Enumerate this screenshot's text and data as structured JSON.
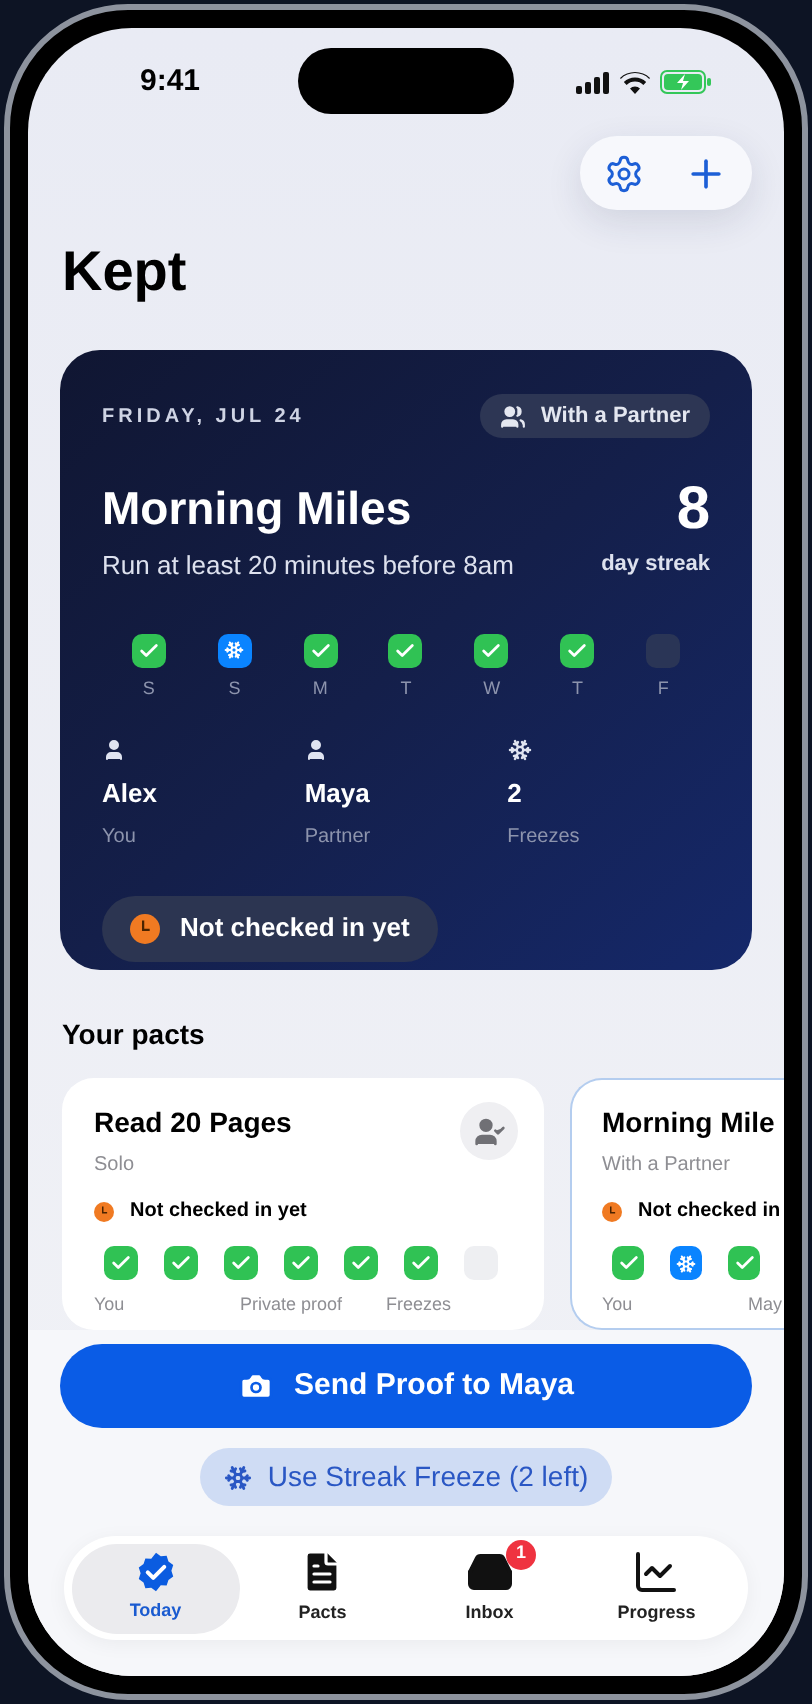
{
  "status_bar": {
    "time": "9:41"
  },
  "header": {
    "title": "Kept"
  },
  "hero": {
    "date": "FRIDAY, JUL 24",
    "badge": "With a Partner",
    "title": "Morning Miles",
    "subtitle": "Run at least 20 minutes before 8am",
    "streak": "8",
    "streak_label": "day streak",
    "days": [
      {
        "label": "S",
        "kind": "check"
      },
      {
        "label": "S",
        "kind": "freeze"
      },
      {
        "label": "M",
        "kind": "check"
      },
      {
        "label": "T",
        "kind": "check"
      },
      {
        "label": "W",
        "kind": "check"
      },
      {
        "label": "T",
        "kind": "check"
      },
      {
        "label": "F",
        "kind": "empty"
      }
    ],
    "stats": [
      {
        "kind": "person",
        "value": "Alex",
        "label": "You"
      },
      {
        "kind": "person",
        "value": "Maya",
        "label": "Partner"
      },
      {
        "kind": "freeze",
        "value": "2",
        "label": "Freezes"
      }
    ],
    "status": "Not checked in yet"
  },
  "pacts_section": {
    "title": "Your pacts",
    "pacts": [
      {
        "title": "Read 20 Pages",
        "subtitle": "Solo",
        "selected": false,
        "status": "Not checked in yet",
        "days": [
          {
            "kind": "check"
          },
          {
            "kind": "check"
          },
          {
            "kind": "check"
          },
          {
            "kind": "check"
          },
          {
            "kind": "check"
          },
          {
            "kind": "check"
          },
          {
            "kind": "empty"
          }
        ],
        "labels": [
          "You",
          "Private proof",
          "Freezes"
        ]
      },
      {
        "title": "Morning Mile",
        "subtitle": "With a Partner",
        "selected": true,
        "status": "Not checked in",
        "days": [
          {
            "kind": "check"
          },
          {
            "kind": "freeze"
          },
          {
            "kind": "check"
          }
        ],
        "labels": [
          "You",
          "May"
        ]
      }
    ]
  },
  "actions": {
    "primary": "Send Proof to Maya",
    "secondary": "Use Streak Freeze (2 left)"
  },
  "tabs": [
    {
      "kind": "today",
      "label": "Today",
      "selected": true
    },
    {
      "kind": "pacts",
      "label": "Pacts",
      "selected": false
    },
    {
      "kind": "inbox",
      "label": "Inbox",
      "selected": false,
      "badge": "1"
    },
    {
      "kind": "progress",
      "label": "Progress",
      "selected": false
    }
  ]
}
